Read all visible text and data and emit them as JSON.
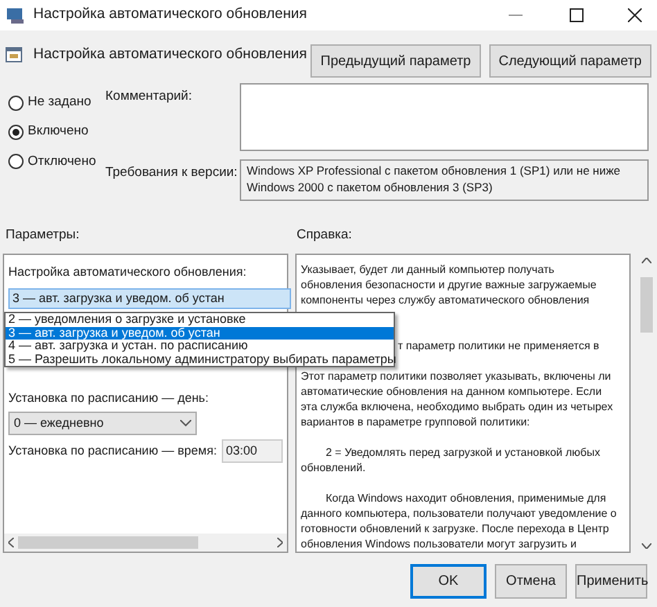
{
  "window": {
    "title": "Настройка автоматического обновления"
  },
  "heading": "Настройка автоматического обновления",
  "nav_buttons": [
    "Предыдущий параметр",
    "Следующий параметр"
  ],
  "states": [
    {
      "label": "Не задано",
      "selected": false
    },
    {
      "label": "Включено",
      "selected": true
    },
    {
      "label": "Отключено",
      "selected": false
    }
  ],
  "comment": {
    "label": "Комментарий:"
  },
  "requirements": {
    "label": "Требования к версии:",
    "text": "Windows XP Professional с пакетом обновления 1 (SP1) или не ниже Windows 2000 с пакетом обновления 3 (SP3)"
  },
  "parameters": {
    "label": "Параметры:",
    "setting_label": "Настройка автоматического обновления:",
    "setting_value": "3 — авт. загрузка и уведом. об устан",
    "options": [
      {
        "label": "2 — уведомления о загрузке и установке",
        "selected": false
      },
      {
        "label": "3 — авт. загрузка и уведом. об устан",
        "selected": true
      },
      {
        "label": "4 — авт. загрузка и устан. по расписанию",
        "selected": false
      },
      {
        "label": "5 — Разрешить локальному администратору выбирать параметры",
        "selected": false
      }
    ],
    "day_label": "Установка по расписанию — день:",
    "day_value": "0 — ежедневно",
    "time_label": "Установка по расписанию — время:",
    "time_value": "03:00"
  },
  "help": {
    "label": "Справка:",
    "lines": [
      {
        "kind": "text",
        "text": "Указывает, будет ли данный компьютер получать"
      },
      {
        "kind": "text",
        "text": "обновления безопасности и другие важные загружаемые"
      },
      {
        "kind": "text",
        "text": "компоненты через службу автоматического обновления"
      },
      {
        "kind": "covered"
      },
      {
        "kind": "covered"
      },
      {
        "kind": "partial",
        "text": "т параметр политики не применяется в"
      },
      {
        "kind": "blank"
      },
      {
        "kind": "text",
        "text": "Этот параметр политики позволяет указывать, включены ли"
      },
      {
        "kind": "text",
        "text": "автоматические обновления на данном компьютере. Если"
      },
      {
        "kind": "text",
        "text": "эта служба включена, необходимо выбрать один из четырех"
      },
      {
        "kind": "text",
        "text": "вариантов в параметре групповой политики:"
      },
      {
        "kind": "blank"
      },
      {
        "kind": "indent",
        "text": "2 = Уведомлять перед загрузкой и установкой любых"
      },
      {
        "kind": "text",
        "text": "обновлений."
      },
      {
        "kind": "blank"
      },
      {
        "kind": "indent",
        "text": "Когда Windows находит обновления, применимые для"
      },
      {
        "kind": "text",
        "text": "данного компьютера, пользователи получают уведомление о"
      },
      {
        "kind": "text",
        "text": "готовности обновлений к загрузке. После перехода в Центр"
      },
      {
        "kind": "text",
        "text": "обновления Windows пользователи могут загрузить и"
      }
    ]
  },
  "buttons": [
    {
      "label": "OK",
      "kind": "default"
    },
    {
      "label": "Отмена",
      "kind": "normal"
    },
    {
      "label": "Применить",
      "kind": "normal"
    }
  ]
}
